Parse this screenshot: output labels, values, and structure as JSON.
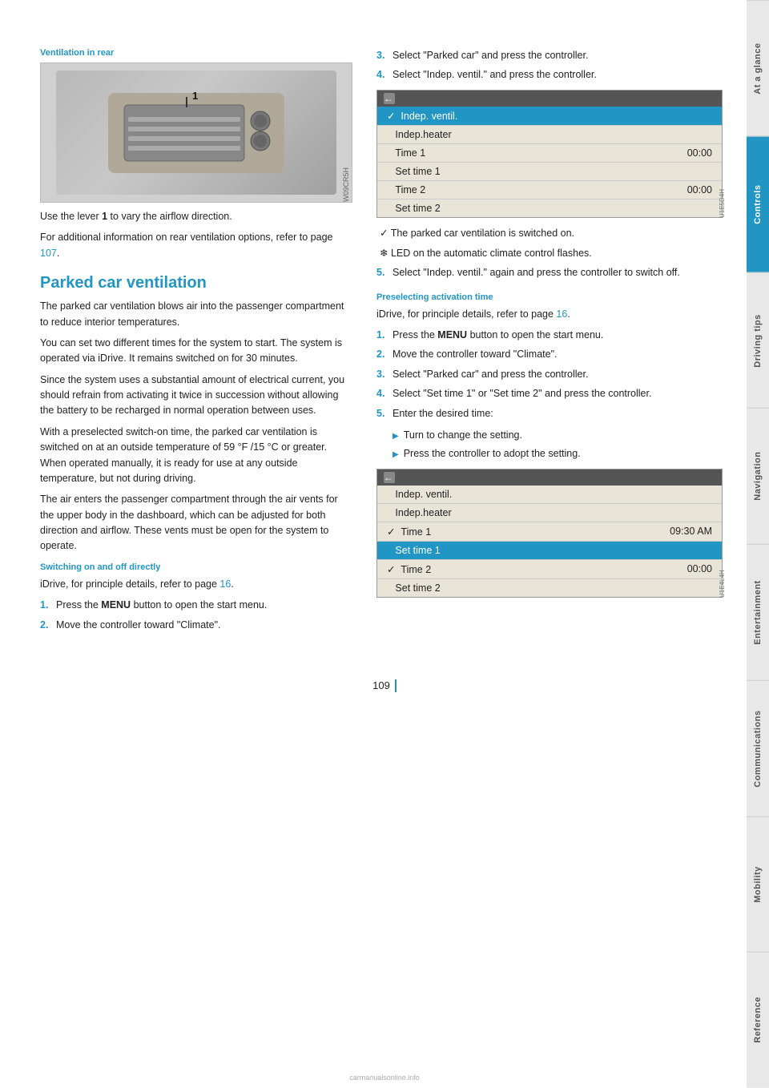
{
  "sidetabs": [
    {
      "label": "At a glance",
      "active": false
    },
    {
      "label": "Controls",
      "active": true
    },
    {
      "label": "Driving tips",
      "active": false
    },
    {
      "label": "Navigation",
      "active": false
    },
    {
      "label": "Entertainment",
      "active": false
    },
    {
      "label": "Communications",
      "active": false
    },
    {
      "label": "Mobility",
      "active": false
    },
    {
      "label": "Reference",
      "active": false
    }
  ],
  "left": {
    "ventilation_heading": "Ventilation in rear",
    "image_label": "1",
    "image_wm": "W09CR5H",
    "caption1": "Use the lever 1 to vary the airflow direction.",
    "caption2": "For additional information on rear ventilation options, refer to page 107.",
    "parked_heading": "Parked car ventilation",
    "para1": "The parked car ventilation blows air into the passenger compartment to reduce interior temperatures.",
    "para2": "You can set two different times for the system to start. The system is operated via iDrive. It remains switched on for 30 minutes.",
    "para3": "Since the system uses a substantial amount of electrical current, you should refrain from activating it twice in succession without allowing the battery to be recharged in normal operation between uses.",
    "para4": "With a preselected switch-on time, the parked car ventilation is switched on at an outside temperature of 59 °F /15 °C or greater. When operated manually, it is ready for use at any outside temperature, but not during driving.",
    "para5": "The air enters the passenger compartment through the air vents for the upper body in the dashboard, which can be adjusted for both direction and airflow. These vents must be open for the system to operate.",
    "switch_heading": "Switching on and off directly",
    "switch_idrive_note": "iDrive, for principle details, refer to page 16.",
    "switch_steps": [
      {
        "num": "1.",
        "text": "Press the MENU button to open the start menu."
      },
      {
        "num": "2.",
        "text": "Move the controller toward \"Climate\"."
      }
    ],
    "page107_ref": "107",
    "page16_ref": "16"
  },
  "right": {
    "step3": "Select \"Parked car\" and press the controller.",
    "step4": "Select \"Indep. ventil.\" and press the controller.",
    "menu1": {
      "wm": "U1E5D4H",
      "rows": [
        {
          "label": "✓  Indep. ventil.",
          "value": "",
          "selected": true
        },
        {
          "label": "   Indep.heater",
          "value": "",
          "selected": false
        },
        {
          "label": "   Time 1",
          "value": "00:00",
          "selected": false
        },
        {
          "label": "   Set time 1",
          "value": "",
          "selected": false
        },
        {
          "label": "   Time 2",
          "value": "00:00",
          "selected": false
        },
        {
          "label": "   Set time 2",
          "value": "",
          "selected": false
        }
      ]
    },
    "note1": "✓ The parked car ventilation is switched on.",
    "note2": "❄ LED on the automatic climate control flashes.",
    "step5": "Select \"Indep. ventil.\" again and press the controller to switch off.",
    "preselect_heading": "Preselecting activation time",
    "preselect_idrive_note": "iDrive, for principle details, refer to page 16.",
    "preselect_steps": [
      {
        "num": "1.",
        "text": "Press the MENU button to open the start menu."
      },
      {
        "num": "2.",
        "text": "Move the controller toward \"Climate\"."
      },
      {
        "num": "3.",
        "text": "Select \"Parked car\" and press the controller."
      },
      {
        "num": "4.",
        "text": "Select \"Set time 1\" or \"Set time 2\" and press the controller."
      },
      {
        "num": "5.",
        "text": "Enter the desired time:"
      }
    ],
    "bullet_items": [
      "Turn to change the setting.",
      "Press the controller to adopt the setting."
    ],
    "menu2": {
      "wm": "U1E4L4H",
      "rows": [
        {
          "label": "   Indep. ventil.",
          "value": "",
          "selected": false
        },
        {
          "label": "   Indep.heater",
          "value": "",
          "selected": false
        },
        {
          "label": "✓  Time 1",
          "value": "09:30 AM",
          "selected": false
        },
        {
          "label": "   Set time 1",
          "value": "",
          "selected": true
        },
        {
          "label": "✓  Time 2",
          "value": "00:00",
          "selected": false
        },
        {
          "label": "   Set time 2",
          "value": "",
          "selected": false
        }
      ]
    }
  },
  "page_number": "109"
}
